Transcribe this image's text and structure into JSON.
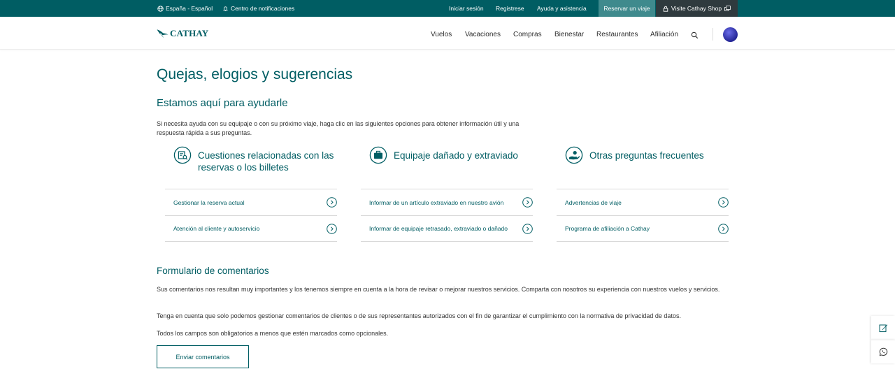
{
  "topbar": {
    "locale": "España - Español",
    "notifications": "Centro de notificaciones",
    "login": "Iniciar sesión",
    "register": "Registrese",
    "help": "Ayuda y asistencia",
    "book": "Reservar un viaje",
    "shop": "Visite Cathay Shop"
  },
  "header": {
    "logo": "CATHAY",
    "nav": [
      "Vuelos",
      "Vacaciones",
      "Compras",
      "Bienestar",
      "Restaurantes",
      "Afiliación"
    ]
  },
  "main": {
    "title": "Quejas, elogios y sugerencias",
    "subtitle": "Estamos aquí para ayudarle",
    "intro": "Si necesita ayuda con su equipaje o con su próximo viaje, haga clic en las siguientes opciones para obtener información útil y una respuesta rápida a sus preguntas.",
    "columns": [
      {
        "title": "Cuestiones relacionadas con las reservas o los billetes",
        "icon": "booking-search-icon",
        "links": [
          "Gestionar la reserva actual",
          "Atención al cliente y autoservicio"
        ]
      },
      {
        "title": "Equipaje dañado y extraviado",
        "icon": "briefcase-icon",
        "links": [
          "Informar de un artículo extraviado en nuestro avión",
          "Informar de equipaje retrasado, extraviado o dañado"
        ]
      },
      {
        "title": "Otras preguntas frecuentes",
        "icon": "hand-help-icon",
        "links": [
          "Advertencias de viaje",
          "Programa de afiliación a Cathay"
        ]
      }
    ],
    "form_title": "Formulario de comentarios",
    "para1": "Sus comentarios nos resultan muy importantes y los tenemos siempre en cuenta a la hora de revisar o mejorar nuestros servicios. Comparta con nosotros su experiencia con nuestros vuelos y servicios.",
    "para2": "Tenga en cuenta que solo podemos gestionar comentarios de clientes o de sus representantes autorizados con el fin de garantizar el cumplimiento con la normativa de privacidad de datos.",
    "para3": "Todos los campos son obligatorios a menos que estén marcados como opcionales.",
    "button": "Enviar comentarios"
  },
  "colors": {
    "brand": "#005d63",
    "topbar": "#005d63",
    "shop_bg": "#2f3a3e",
    "book_bg": "#3f8a8d"
  }
}
